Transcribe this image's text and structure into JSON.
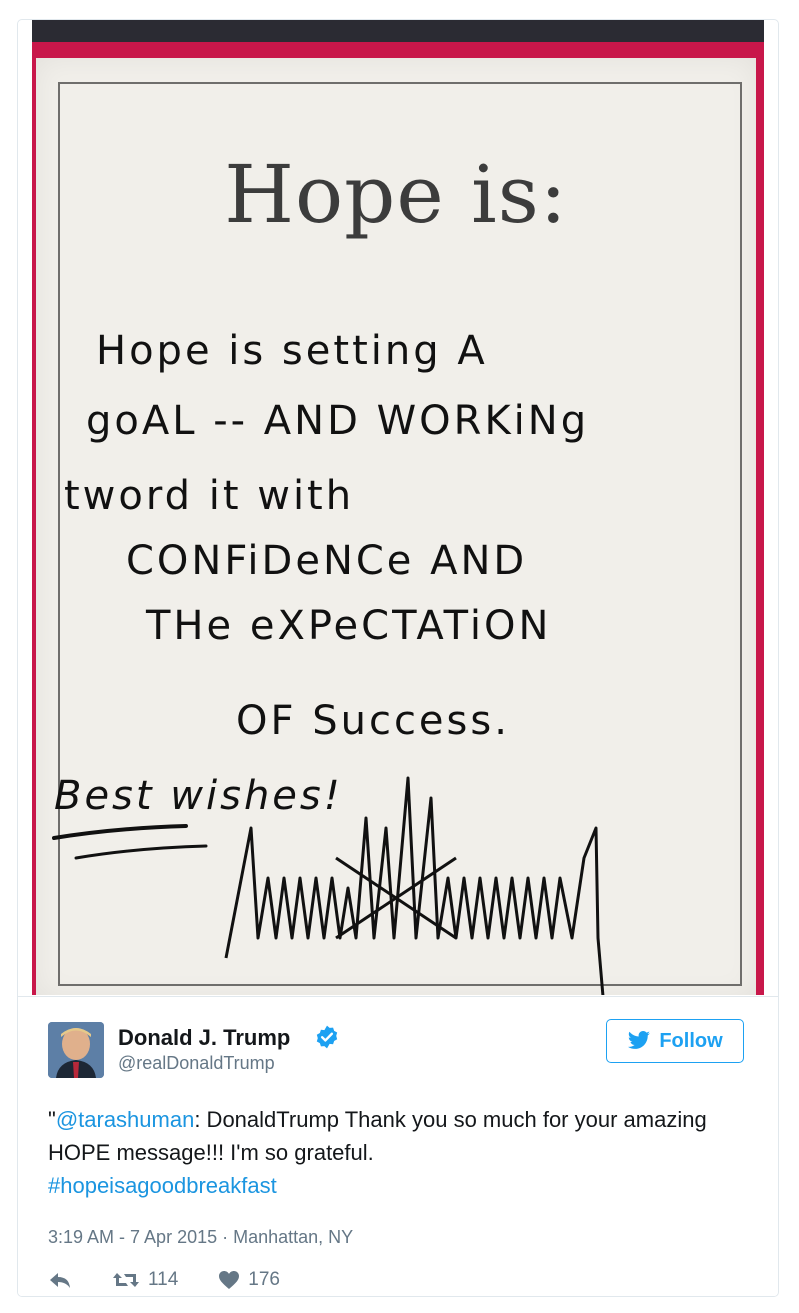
{
  "photo": {
    "title": "Hope is:",
    "handwriting": [
      "Hope is setting A",
      "goAL -- AND WORKiNg",
      "tword it with",
      "CONFiDeNCe AND",
      "THe eXPeCTATiON",
      "OF Success.",
      "Best wishes!"
    ]
  },
  "tweet": {
    "author_name": "Donald J. Trump",
    "author_handle": "@realDonaldTrump",
    "follow_label": "Follow",
    "text_prefix": "\"",
    "mention": "@tarashuman",
    "text_body": ": DonaldTrump Thank you so much for your amazing HOPE message!!! I'm so grateful.",
    "hashtag": "#hopeisagoodbreakfast",
    "timestamp": "3:19 AM - 7 Apr 2015 · Manhattan, NY",
    "retweets": "114",
    "likes": "176"
  },
  "icons": {
    "reply": "reply-icon",
    "retweet": "retweet-icon",
    "like": "heart-icon",
    "verified": "verified-badge-icon",
    "bird": "twitter-bird-icon"
  },
  "colors": {
    "link": "#1b95e0",
    "follow": "#1da1f2",
    "meta_text": "#657786",
    "photo_background": "#c8174a"
  }
}
